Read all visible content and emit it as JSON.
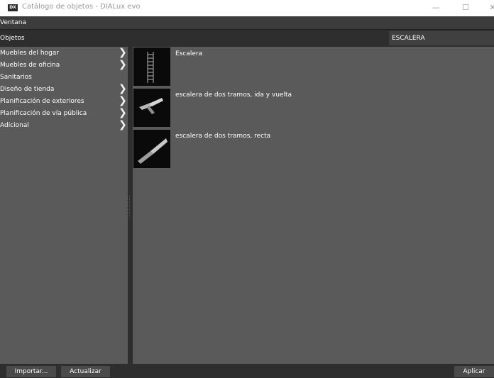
{
  "window": {
    "app_icon_text": "DX",
    "title": "Catálogo de objetos - DIALux evo",
    "minimize": "—",
    "maximize": "☐",
    "close": "✕"
  },
  "menu": {
    "ventana": "Ventana"
  },
  "header": {
    "label": "Objetos",
    "search_value": "ESCALERA"
  },
  "sidebar": {
    "items": [
      {
        "label": "Muebles del hogar",
        "has_submenu": true
      },
      {
        "label": "Muebles de oficina",
        "has_submenu": true
      },
      {
        "label": "Sanitarios",
        "has_submenu": false
      },
      {
        "label": "Diseño de tienda",
        "has_submenu": true
      },
      {
        "label": "Planificación de exteriores",
        "has_submenu": true
      },
      {
        "label": "Planificación de vía pública",
        "has_submenu": true
      },
      {
        "label": "Adicional",
        "has_submenu": true
      }
    ],
    "chevron": "❯"
  },
  "objects": [
    {
      "label": "Escalera",
      "thumbnail": "ladder-icon"
    },
    {
      "label": "escalera de dos tramos, ida y vuelta",
      "thumbnail": "two-flight-return-stair-icon"
    },
    {
      "label": "escalera de dos tramos, recta",
      "thumbnail": "two-flight-straight-stair-icon"
    }
  ],
  "footer": {
    "import": "Importar...",
    "refresh": "Actualizar",
    "apply": "Aplicar"
  },
  "colors": {
    "panel": "#5a5a5a",
    "dark": "#2e2e2e",
    "thumb_bg": "#0a0a0a"
  }
}
